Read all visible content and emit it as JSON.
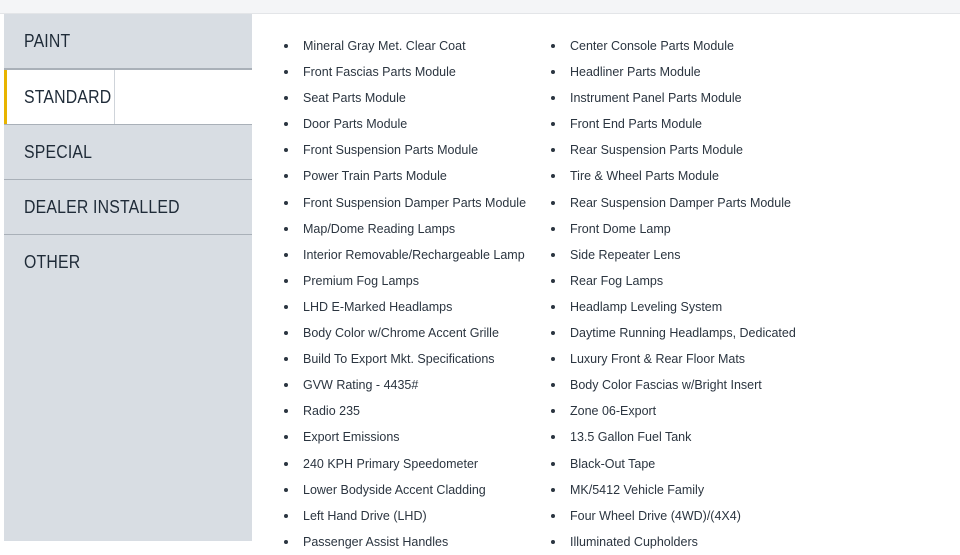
{
  "sidebar": {
    "tabs": [
      {
        "label": "PAINT",
        "active": false
      },
      {
        "label": "STANDARD",
        "active": true
      },
      {
        "label": "SPECIAL",
        "active": false
      },
      {
        "label": "DEALER INSTALLED",
        "active": false
      },
      {
        "label": "OTHER",
        "active": false
      }
    ]
  },
  "colors": {
    "accent": "#e8b400",
    "sidebar_bg": "#d8dde3",
    "text": "#2b3540"
  },
  "features": {
    "left": [
      "Mineral Gray Met. Clear Coat",
      "Front Fascias Parts Module",
      "Seat Parts Module",
      "Door Parts Module",
      "Front Suspension Parts Module",
      "Power Train Parts Module",
      "Front Suspension Damper Parts Module",
      "Map/Dome Reading Lamps",
      "Interior Removable/Rechargeable Lamp",
      "Premium Fog Lamps",
      "LHD E-Marked Headlamps",
      "Body Color w/Chrome Accent Grille",
      "Build To Export Mkt. Specifications",
      "GVW Rating - 4435#",
      "Radio 235",
      "Export Emissions",
      "240 KPH Primary Speedometer",
      "Lower Bodyside Accent Cladding",
      "Left Hand Drive (LHD)",
      "Passenger Assist Handles"
    ],
    "right": [
      "Center Console Parts Module",
      "Headliner Parts Module",
      "Instrument Panel Parts Module",
      "Front End Parts Module",
      "Rear Suspension Parts Module",
      "Tire & Wheel Parts Module",
      "Rear Suspension Damper Parts Module",
      "Front Dome Lamp",
      "Side Repeater Lens",
      "Rear Fog Lamps",
      "Headlamp Leveling System",
      "Daytime Running Headlamps, Dedicated",
      "Luxury Front & Rear Floor Mats",
      "Body Color Fascias w/Bright Insert",
      "Zone 06-Export",
      "13.5 Gallon Fuel Tank",
      "Black-Out Tape",
      "MK/5412 Vehicle Family",
      "Four Wheel Drive (4WD)/(4X4)",
      "Illuminated Cupholders"
    ]
  }
}
